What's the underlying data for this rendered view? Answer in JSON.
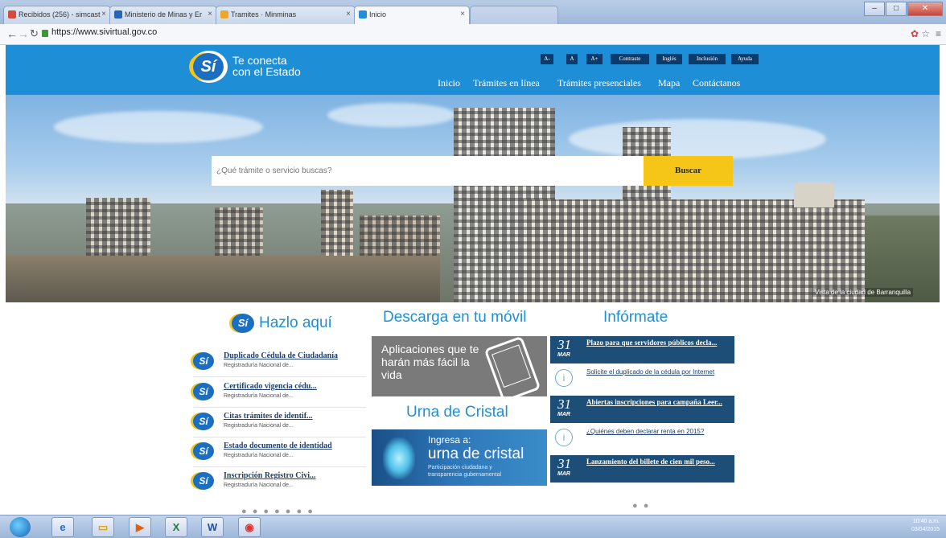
{
  "browser": {
    "tabs": [
      {
        "label": "Recibidos (256) - simcast",
        "icon_color": "#d54b3d"
      },
      {
        "label": "Ministerio de Minas y Er",
        "icon_color": "#2a64b8"
      },
      {
        "label": "Tramites · Minminas",
        "icon_color": "#e8a92a"
      },
      {
        "label": "Inicio",
        "icon_color": "#1e8fd6"
      }
    ],
    "url": "https://www.sivirtual.gov.co",
    "back_icon": "back-arrow-icon",
    "forward_icon": "forward-arrow-icon",
    "reload_icon": "reload-icon"
  },
  "site": {
    "tagline_1": "Te conecta",
    "tagline_2": "con el Estado",
    "logo_text": "Sí",
    "tools": [
      "A-",
      "A",
      "A+",
      "Contraste",
      "Inglés",
      "Inclusión",
      "Ayuda"
    ],
    "nav": [
      "Inicio",
      "Trámites en línea",
      "Trámites presenciales",
      "Mapa",
      "Contáctanos"
    ],
    "search_placeholder": "¿Qué trámite o servicio buscas?",
    "search_button": "Buscar",
    "hero_caption": "Vista de la ciudad de Barranquilla",
    "brand_color": "#1e8fd6",
    "accent_color": "#f5c518"
  },
  "hazlo": {
    "title": "Hazlo aquí",
    "items": [
      {
        "title": "Duplicado Cédula de Ciudadanía",
        "sub": "Registraduría Nacional de..."
      },
      {
        "title": "Certificado vigencia cédu...",
        "sub": "Registraduría Nacional de..."
      },
      {
        "title": "Citas trámites de identif...",
        "sub": "Registraduría Nacional de..."
      },
      {
        "title": "Estado documento de identidad",
        "sub": "Registraduría Nacional de..."
      },
      {
        "title": "Inscripción Registro Civi...",
        "sub": "Registraduría Nacional de..."
      }
    ],
    "dots": "● ● ● ● ● ● ●"
  },
  "movil": {
    "title": "Descarga en tu móvil",
    "banner_text": "Aplicaciones que te harán más fácil la vida"
  },
  "urna": {
    "title": "Urna de Cristal",
    "line1": "Ingresa a:",
    "line2": "urna de cristal",
    "line3": "Participación ciudadana y transparencia gubernamental"
  },
  "informate": {
    "title": "Infórmate",
    "news": [
      {
        "type": "dark",
        "day": "31",
        "month": "MAR",
        "title": "Plazo para que servidores públicos decla..."
      },
      {
        "type": "light",
        "title": "Solicite el duplicado de la cédula por Internet"
      },
      {
        "type": "dark",
        "day": "31",
        "month": "MAR",
        "title": "Abiertas inscripciones para campaña Leer..."
      },
      {
        "type": "light",
        "title": "¿Quiénes deben declarar renta en 2015?"
      },
      {
        "type": "dark",
        "day": "31",
        "month": "MAR",
        "title": "Lanzamiento del billete de cien mil peso..."
      }
    ],
    "dots": "● ●"
  },
  "taskbar": {
    "apps": [
      "start-orb-icon",
      "internet-explorer-icon",
      "file-explorer-icon",
      "media-player-icon",
      "excel-icon",
      "word-icon",
      "chrome-icon"
    ],
    "time": "10:40 a.m.",
    "date": "03/04/2015"
  }
}
